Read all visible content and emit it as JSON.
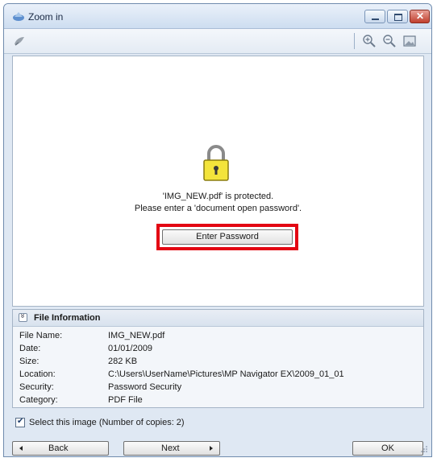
{
  "window": {
    "title": "Zoom in"
  },
  "toolbar": {
    "icons": [
      "wing-icon",
      "zoom-in-icon",
      "zoom-out-icon",
      "full-screen-icon"
    ]
  },
  "preview": {
    "message_line1": "'IMG_NEW.pdf' is protected.",
    "message_line2": "Please enter a 'document open password'.",
    "enter_password_label": "Enter Password",
    "highlight_color": "#e30613"
  },
  "file_info": {
    "title": "File Information",
    "rows": [
      {
        "key": "File Name:",
        "value": "IMG_NEW.pdf"
      },
      {
        "key": "Date:",
        "value": "01/01/2009"
      },
      {
        "key": "Size:",
        "value": "282 KB"
      },
      {
        "key": "Location:",
        "value": "C:\\Users\\UserName\\Pictures\\MP Navigator EX\\2009_01_01"
      },
      {
        "key": "Security:",
        "value": "Password Security"
      },
      {
        "key": "Category:",
        "value": "PDF File"
      }
    ]
  },
  "select_image": {
    "label": "Select this image (Number of copies: 2)",
    "checked": true
  },
  "buttons": {
    "back": "Back",
    "next": "Next",
    "ok": "OK"
  }
}
